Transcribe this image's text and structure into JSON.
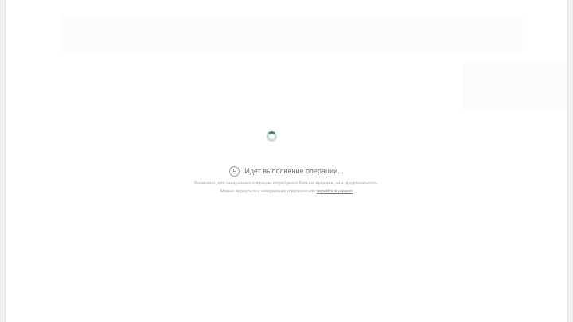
{
  "status": {
    "title": "Идет выполнение операции..."
  },
  "description": {
    "line1": "Возможно, для завершения операции потребуется больше времени, чем предполагалось.",
    "line2": "Можно вернуться к завершению операции или",
    "link": "перейти в начало"
  },
  "colors": {
    "spinner_accent": "#3e8b79",
    "background": "#ffffff"
  },
  "icons": [
    "loading-spinner-icon",
    "clock-icon"
  ]
}
